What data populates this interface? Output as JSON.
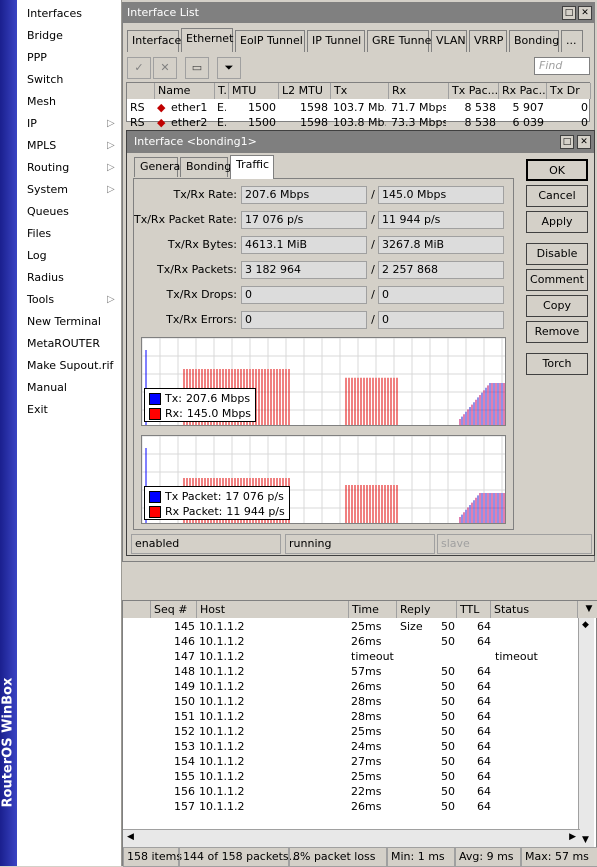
{
  "brand": "RouterOS WinBox",
  "nav": [
    {
      "label": "Interfaces",
      "arrow": false
    },
    {
      "label": "Bridge",
      "arrow": false
    },
    {
      "label": "PPP",
      "arrow": false
    },
    {
      "label": "Switch",
      "arrow": false
    },
    {
      "label": "Mesh",
      "arrow": false
    },
    {
      "label": "IP",
      "arrow": true
    },
    {
      "label": "MPLS",
      "arrow": true
    },
    {
      "label": "Routing",
      "arrow": true
    },
    {
      "label": "System",
      "arrow": true
    },
    {
      "label": "Queues",
      "arrow": false
    },
    {
      "label": "Files",
      "arrow": false
    },
    {
      "label": "Log",
      "arrow": false
    },
    {
      "label": "Radius",
      "arrow": false
    },
    {
      "label": "Tools",
      "arrow": true
    },
    {
      "label": "New Terminal",
      "arrow": false
    },
    {
      "label": "MetaROUTER",
      "arrow": false
    },
    {
      "label": "Make Supout.rif",
      "arrow": false
    },
    {
      "label": "Manual",
      "arrow": false
    },
    {
      "label": "Exit",
      "arrow": false
    }
  ],
  "interface_list": {
    "title": "Interface List",
    "tabs": [
      "Interface",
      "Ethernet",
      "EoIP Tunnel",
      "IP Tunnel",
      "GRE Tunnel",
      "VLAN",
      "VRRP",
      "Bonding",
      "..."
    ],
    "active_tab": "Ethernet",
    "find_placeholder": "Find",
    "columns": [
      "Name",
      "T.",
      "MTU",
      "L2 MTU",
      "Tx",
      "Rx",
      "Tx Pac...",
      "Rx Pac...",
      "Tx Dr"
    ],
    "rows": [
      {
        "flags": "RS",
        "name": "ether1",
        "type": "E...",
        "mtu": "1500",
        "l2mtu": "1598",
        "tx": "103.7 Mb...",
        "rx": "71.7 Mbps",
        "txp": "8 538",
        "rxp": "5 907",
        "txd": "0"
      },
      {
        "flags": "RS",
        "name": "ether2",
        "type": "E...",
        "mtu": "1500",
        "l2mtu": "1598",
        "tx": "103.8 Mb...",
        "rx": "73.3 Mbps",
        "txp": "8 538",
        "rxp": "6 039",
        "txd": "0"
      }
    ]
  },
  "dialog": {
    "title": "Interface <bonding1>",
    "tabs": [
      "General",
      "Bonding",
      "Traffic"
    ],
    "active_tab": "Traffic",
    "fields": [
      {
        "label": "Tx/Rx Rate:",
        "tx": "207.6 Mbps",
        "rx": "145.0 Mbps"
      },
      {
        "label": "Tx/Rx Packet Rate:",
        "tx": "17 076 p/s",
        "rx": "11 944 p/s"
      },
      {
        "label": "Tx/Rx Bytes:",
        "tx": "4613.1 MiB",
        "rx": "3267.8 MiB"
      },
      {
        "label": "Tx/Rx Packets:",
        "tx": "3 182 964",
        "rx": "2 257 868"
      },
      {
        "label": "Tx/Rx Drops:",
        "tx": "0",
        "rx": "0"
      },
      {
        "label": "Tx/Rx Errors:",
        "tx": "0",
        "rx": "0"
      }
    ],
    "separator": "/",
    "graph1_legend": [
      {
        "label": "Tx:",
        "value": "207.6 Mbps",
        "color": "#0000ff"
      },
      {
        "label": "Rx:",
        "value": "145.0 Mbps",
        "color": "#ff0000"
      }
    ],
    "graph2_legend": [
      {
        "label": "Tx Packet:",
        "value": "17 076 p/s",
        "color": "#0000ff"
      },
      {
        "label": "Rx Packet:",
        "value": "11 944 p/s",
        "color": "#ff0000"
      }
    ],
    "buttons": [
      "OK",
      "Cancel",
      "Apply",
      "Disable",
      "Comment",
      "Copy",
      "Remove",
      "Torch"
    ],
    "status": [
      "enabled",
      "running",
      "slave"
    ]
  },
  "ping": {
    "columns": [
      "Seq #",
      "Host",
      "Time",
      "Reply Size",
      "TTL",
      "Status"
    ],
    "rows": [
      {
        "seq": "145",
        "host": "10.1.1.2",
        "time": "25ms",
        "size": "50",
        "ttl": "64",
        "status": ""
      },
      {
        "seq": "146",
        "host": "10.1.1.2",
        "time": "26ms",
        "size": "50",
        "ttl": "64",
        "status": ""
      },
      {
        "seq": "147",
        "host": "10.1.1.2",
        "time": "timeout",
        "size": "",
        "ttl": "",
        "status": "timeout"
      },
      {
        "seq": "148",
        "host": "10.1.1.2",
        "time": "57ms",
        "size": "50",
        "ttl": "64",
        "status": ""
      },
      {
        "seq": "149",
        "host": "10.1.1.2",
        "time": "26ms",
        "size": "50",
        "ttl": "64",
        "status": ""
      },
      {
        "seq": "150",
        "host": "10.1.1.2",
        "time": "28ms",
        "size": "50",
        "ttl": "64",
        "status": ""
      },
      {
        "seq": "151",
        "host": "10.1.1.2",
        "time": "28ms",
        "size": "50",
        "ttl": "64",
        "status": ""
      },
      {
        "seq": "152",
        "host": "10.1.1.2",
        "time": "25ms",
        "size": "50",
        "ttl": "64",
        "status": ""
      },
      {
        "seq": "153",
        "host": "10.1.1.2",
        "time": "24ms",
        "size": "50",
        "ttl": "64",
        "status": ""
      },
      {
        "seq": "154",
        "host": "10.1.1.2",
        "time": "27ms",
        "size": "50",
        "ttl": "64",
        "status": ""
      },
      {
        "seq": "155",
        "host": "10.1.1.2",
        "time": "25ms",
        "size": "50",
        "ttl": "64",
        "status": ""
      },
      {
        "seq": "156",
        "host": "10.1.1.2",
        "time": "22ms",
        "size": "50",
        "ttl": "64",
        "status": ""
      },
      {
        "seq": "157",
        "host": "10.1.1.2",
        "time": "26ms",
        "size": "50",
        "ttl": "64",
        "status": ""
      }
    ],
    "status": [
      "158 items",
      "144 of 158 packets...",
      "8% packet loss",
      "Min: 1 ms",
      "Avg: 9 ms",
      "Max: 57 ms"
    ]
  }
}
